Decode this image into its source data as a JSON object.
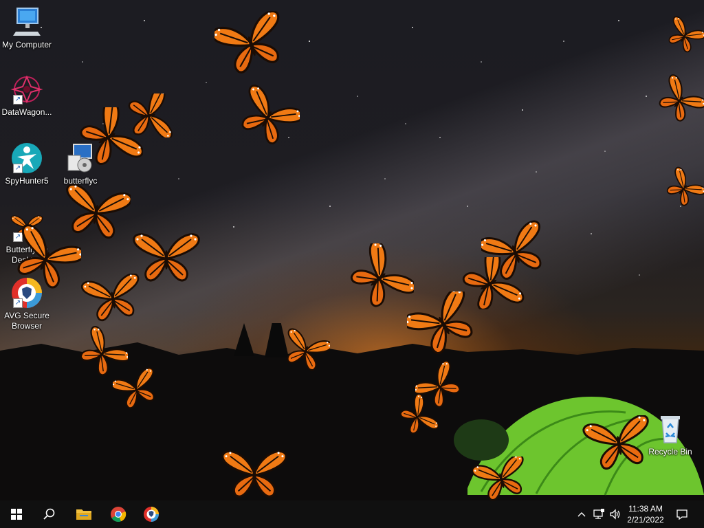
{
  "desktop": {
    "icons": [
      {
        "label": "My Computer",
        "icon": "monitor-icon"
      },
      {
        "label": "DataWagon...",
        "icon": "datawagon-icon"
      },
      {
        "label": "SpyHunter5",
        "icon": "spyhunter-icon"
      },
      {
        "label": "butterflyc",
        "icon": "installer-icon"
      },
      {
        "label": "Butterfly on Desktop",
        "icon": "butterfly-app-icon"
      },
      {
        "label": "AVG Secure Browser",
        "icon": "avg-browser-icon"
      },
      {
        "label": "Recycle Bin",
        "icon": "recycle-bin-icon"
      }
    ]
  },
  "taskbar": {
    "start": "windows-start-icon",
    "search": "search-icon",
    "pinned": [
      {
        "name": "File Explorer",
        "icon": "folder-icon"
      },
      {
        "name": "Google Chrome",
        "icon": "chrome-icon"
      },
      {
        "name": "AVG Secure Browser",
        "icon": "avg-browser-icon"
      }
    ],
    "tray": {
      "chevron": "chevron-up-icon",
      "network": "network-icon",
      "volume": "volume-icon",
      "notification": "notification-icon"
    },
    "clock": {
      "time": "11:38 AM",
      "date": "2/21/2022"
    }
  },
  "colors": {
    "taskbar": "#101010",
    "butterfly_orange": "#f07a14",
    "tent_green": "#7bd23a"
  }
}
